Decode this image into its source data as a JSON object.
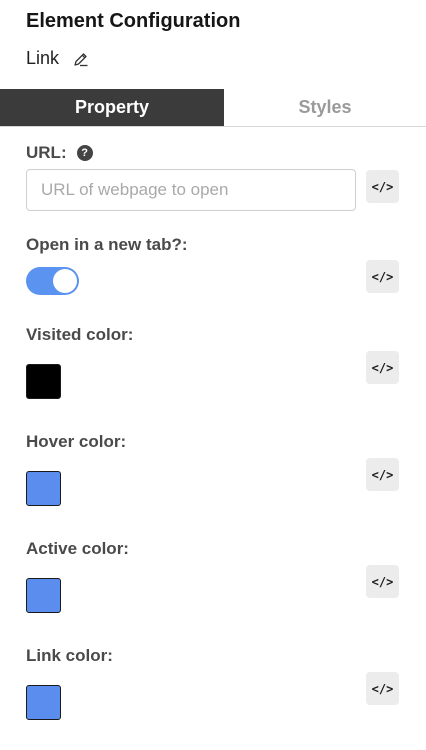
{
  "header": {
    "title": "Element Configuration",
    "subtitle": "Link"
  },
  "tabs": [
    {
      "label": "Property",
      "active": true
    },
    {
      "label": "Styles",
      "active": false
    }
  ],
  "fields": {
    "url": {
      "label": "URL:",
      "placeholder": "URL of webpage to open",
      "value": "",
      "help": "?"
    },
    "new_tab": {
      "label": "Open in a new tab?:",
      "checked": true
    },
    "visited_color": {
      "label": "Visited color:",
      "value": "#000000"
    },
    "hover_color": {
      "label": "Hover color:",
      "value": "#5b8def"
    },
    "active_color": {
      "label": "Active color:",
      "value": "#5b8def"
    },
    "link_color": {
      "label": "Link color:",
      "value": "#5b8def"
    }
  },
  "code_button_label": "</>",
  "colors": {
    "accent": "#5a93f0",
    "active_tab": "#3b3b3b"
  },
  "icons": [
    "edit-icon",
    "help-icon",
    "code-icon"
  ]
}
